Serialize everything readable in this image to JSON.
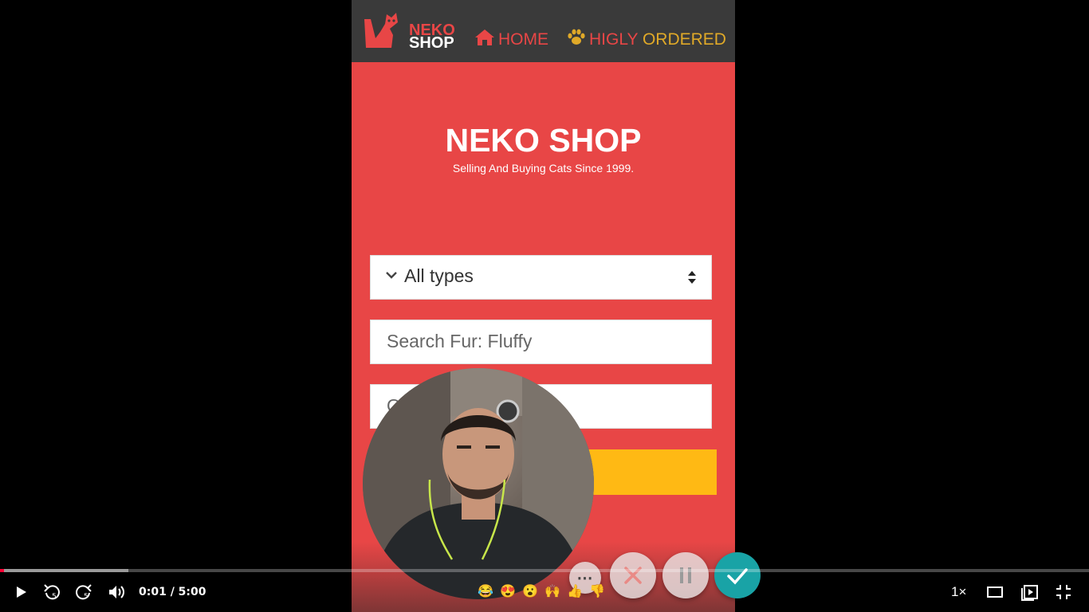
{
  "app": {
    "nav": {
      "logo_top": "NEKO",
      "logo_bottom": "SHOP",
      "home": "HOME",
      "higly": "HIGLY",
      "ordered": "ORDERED"
    },
    "hero": {
      "title": "NEKO SHOP",
      "subtitle": "Selling And Buying Cats Since 1999."
    },
    "form": {
      "type_select_value": "All types",
      "search_placeholder": "Search Fur: Fluffy",
      "third_placeholder_partial": "O"
    },
    "colors": {
      "brand_red": "#e84646",
      "nav_dark": "#3a3a3a",
      "accent_gold": "#e0a928",
      "button_yellow": "#ffb914"
    }
  },
  "recorder": {
    "reactions": [
      "😂",
      "😍",
      "😮",
      "🙌",
      "👍",
      "👎"
    ],
    "icons": [
      "more-icon",
      "cancel-icon",
      "pause-icon",
      "done-icon"
    ]
  },
  "player": {
    "time": "0:01 / 5:00",
    "progress_played_fraction": 0.0033,
    "progress_buffered_fraction": 0.118,
    "speed": "1×",
    "skip_back_seconds": "5",
    "skip_forward_seconds": "5",
    "colors": {
      "progress": "#ff0033"
    }
  }
}
